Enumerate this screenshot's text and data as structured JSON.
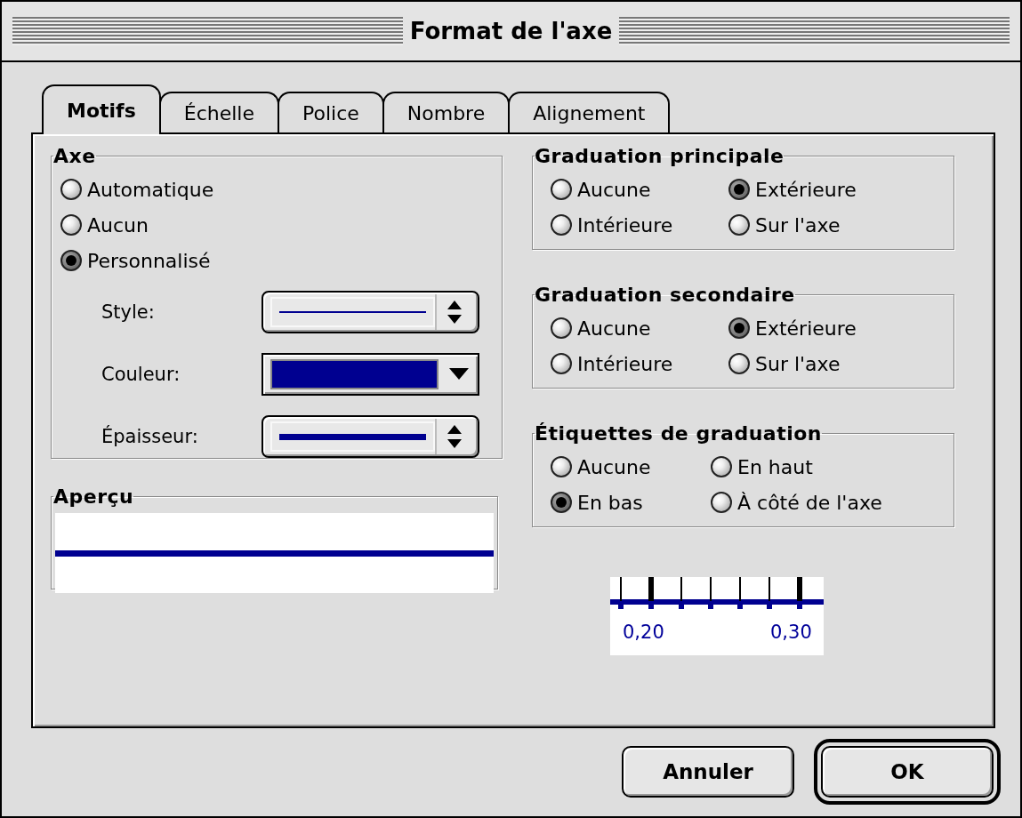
{
  "window": {
    "title": "Format de l'axe"
  },
  "tabs": [
    {
      "label": "Motifs",
      "selected": true
    },
    {
      "label": "Échelle",
      "selected": false
    },
    {
      "label": "Police",
      "selected": false
    },
    {
      "label": "Nombre",
      "selected": false
    },
    {
      "label": "Alignement",
      "selected": false
    }
  ],
  "axis_group": {
    "title": "Axe",
    "options": [
      {
        "label": "Automatique",
        "selected": false
      },
      {
        "label": "Aucun",
        "selected": false
      },
      {
        "label": "Personnalisé",
        "selected": true
      }
    ],
    "style": {
      "label": "Style:"
    },
    "color": {
      "label": "Couleur:",
      "color": "#000090"
    },
    "weight": {
      "label": "Épaisseur:"
    }
  },
  "preview": {
    "title": "Aperçu"
  },
  "tick_groups": [
    {
      "title": "Graduation principale",
      "options": [
        {
          "label": "Aucune",
          "selected": false
        },
        {
          "label": "Extérieure",
          "selected": true
        },
        {
          "label": "Intérieure",
          "selected": false
        },
        {
          "label": "Sur l'axe",
          "selected": false
        }
      ]
    },
    {
      "title": "Graduation secondaire",
      "options": [
        {
          "label": "Aucune",
          "selected": false
        },
        {
          "label": "Extérieure",
          "selected": true
        },
        {
          "label": "Intérieure",
          "selected": false
        },
        {
          "label": "Sur l'axe",
          "selected": false
        }
      ]
    },
    {
      "title": "Étiquettes de graduation",
      "options": [
        {
          "label": "Aucune",
          "selected": false
        },
        {
          "label": "En haut",
          "selected": false
        },
        {
          "label": "En bas",
          "selected": true
        },
        {
          "label": "À côté de l'axe",
          "selected": false
        }
      ]
    }
  ],
  "sample": {
    "labels": [
      "0,20",
      "0,30"
    ]
  },
  "buttons": [
    {
      "label": "Annuler",
      "default": false
    },
    {
      "label": "OK",
      "default": true
    }
  ]
}
